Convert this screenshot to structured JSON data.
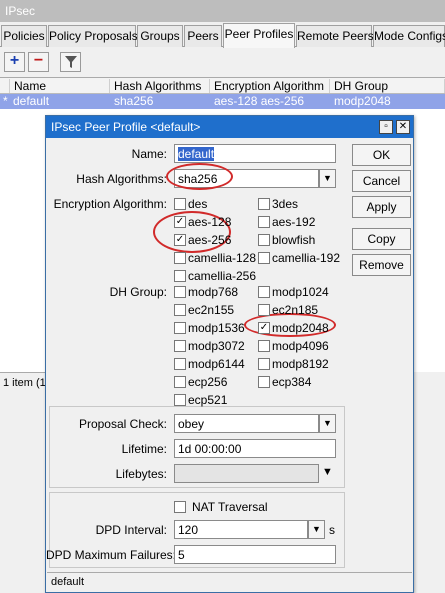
{
  "window": {
    "title": "IPsec"
  },
  "tabs": [
    "Policies",
    "Policy Proposals",
    "Groups",
    "Peers",
    "Peer Profiles",
    "Remote Peers",
    "Mode Configs"
  ],
  "toolbar": {
    "add": "+",
    "remove": "−"
  },
  "table": {
    "headers": [
      "Name",
      "Hash Algorithms",
      "Encryption Algorithm",
      "DH Group"
    ],
    "row": {
      "marker": "*",
      "name": "default",
      "hash": "sha256",
      "enc": "aes-128 aes-256",
      "dh": "modp2048"
    },
    "status": "1 item (1"
  },
  "dialog": {
    "title": "IPsec Peer Profile <default>",
    "fields": {
      "name_label": "Name:",
      "name_value": "default",
      "hash_label": "Hash Algorithms:",
      "hash_value": "sha256",
      "enc_label": "Encryption Algorithm:",
      "dh_label": "DH Group:",
      "proposal_label": "Proposal Check:",
      "proposal_value": "obey",
      "lifetime_label": "Lifetime:",
      "lifetime_value": "1d 00:00:00",
      "lifebytes_label": "Lifebytes:",
      "lifebytes_value": "",
      "nat_label": "NAT Traversal",
      "dpd_interval_label": "DPD Interval:",
      "dpd_interval_value": "120",
      "dpd_interval_unit": "s",
      "dpd_max_label": "DPD Maximum Failures:",
      "dpd_max_value": "5"
    },
    "encryption": [
      {
        "label": "des",
        "checked": false
      },
      {
        "label": "3des",
        "checked": false
      },
      {
        "label": "aes-128",
        "checked": true
      },
      {
        "label": "aes-192",
        "checked": false
      },
      {
        "label": "aes-256",
        "checked": true
      },
      {
        "label": "blowfish",
        "checked": false
      },
      {
        "label": "camellia-128",
        "checked": false
      },
      {
        "label": "camellia-192",
        "checked": false
      },
      {
        "label": "camellia-256",
        "checked": false
      }
    ],
    "dh_groups": [
      {
        "label": "modp768",
        "checked": false
      },
      {
        "label": "modp1024",
        "checked": false
      },
      {
        "label": "ec2n155",
        "checked": false
      },
      {
        "label": "ec2n185",
        "checked": false
      },
      {
        "label": "modp1536",
        "checked": false
      },
      {
        "label": "modp2048",
        "checked": true
      },
      {
        "label": "modp3072",
        "checked": false
      },
      {
        "label": "modp4096",
        "checked": false
      },
      {
        "label": "modp6144",
        "checked": false
      },
      {
        "label": "modp8192",
        "checked": false
      },
      {
        "label": "ecp256",
        "checked": false
      },
      {
        "label": "ecp384",
        "checked": false
      },
      {
        "label": "ecp521",
        "checked": false
      }
    ],
    "buttons": {
      "ok": "OK",
      "cancel": "Cancel",
      "apply": "Apply",
      "copy": "Copy",
      "remove": "Remove"
    },
    "status": "default"
  },
  "colors": {
    "title_bar": "#1f6fcc",
    "selected_row": "#8fa3e8",
    "annotation": "#d12a2a"
  }
}
